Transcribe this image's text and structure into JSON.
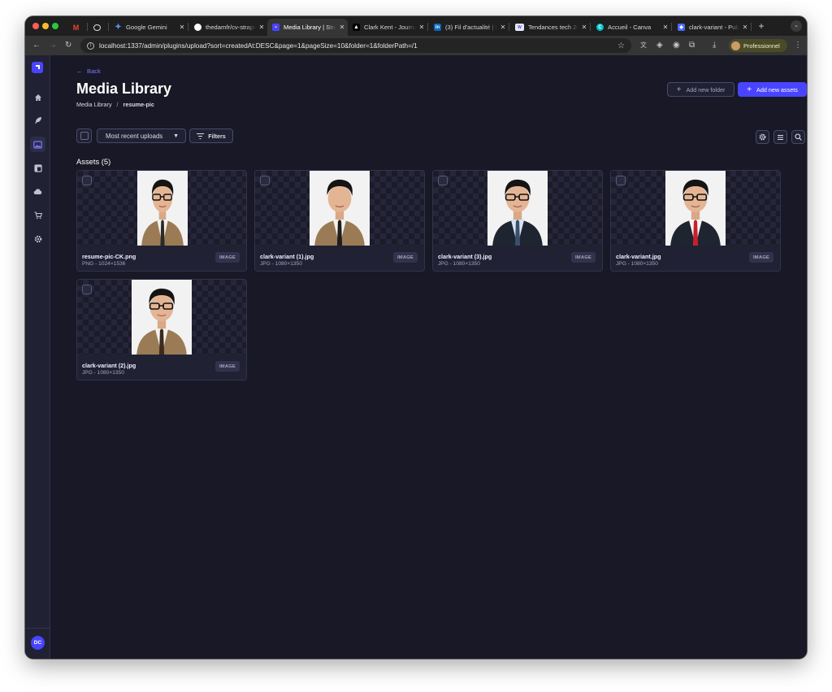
{
  "browser": {
    "tabs": [
      {
        "title": "",
        "favicon": "gmail-icon",
        "color": "#ea4335"
      },
      {
        "title": "",
        "favicon": "openai-icon",
        "color": "#ffffff"
      },
      {
        "title": "Google Gemini",
        "favicon": "gemini-icon",
        "color": "#5b8def"
      },
      {
        "title": "thedamfr/cv-strapi",
        "favicon": "github-icon",
        "color": "#ffffff"
      },
      {
        "title": "Media Library | Strapi",
        "favicon": "strapi-icon",
        "color": "#4945ff"
      },
      {
        "title": "Clark Kent - Journal",
        "favicon": "vercel-icon",
        "color": "#ffffff"
      },
      {
        "title": "(3) Fil d'actualité | LinkedIn",
        "favicon": "linkedin-icon",
        "color": "#0a66c2"
      },
      {
        "title": "Tendances tech 2025",
        "favicon": "news-icon",
        "color": "#7e7eff"
      },
      {
        "title": "Accueil - Canva",
        "favicon": "canva-icon",
        "color": "#00c4cc"
      },
      {
        "title": "clark-variant - Public",
        "favicon": "shield-icon",
        "color": "#4b6bff"
      }
    ],
    "url": "localhost:1337/admin/plugins/upload?sort=createdAt:DESC&page=1&pageSize=10&folder=1&folderPath=/1",
    "profile_label": "Professionnel"
  },
  "sidebar": {
    "items": [
      {
        "name": "home",
        "icon": "home-icon"
      },
      {
        "name": "content-type-builder",
        "icon": "feather-icon"
      },
      {
        "name": "media-library",
        "icon": "image-icon",
        "active": true
      },
      {
        "name": "content-manager",
        "icon": "layout-icon"
      },
      {
        "name": "cloud",
        "icon": "cloud-icon"
      },
      {
        "name": "marketplace",
        "icon": "cart-icon"
      },
      {
        "name": "settings",
        "icon": "gear-icon"
      }
    ],
    "user_initials": "DC"
  },
  "header": {
    "back_label": "Back",
    "title": "Media Library",
    "breadcrumb": [
      "Media Library",
      "resume-pic"
    ],
    "breadcrumb_separator": "/",
    "add_folder_label": "Add new folder",
    "add_assets_label": "Add new assets"
  },
  "toolbar": {
    "sort_label": "Most recent uploads",
    "filters_label": "Filters"
  },
  "assets": {
    "heading": "Assets (5)",
    "items": [
      {
        "name": "resume-pic-CK.png",
        "meta": "PNG - 1024×1536",
        "badge": "IMAGE",
        "tie": "#2a2a2a",
        "suit": "#9a7b55",
        "shirt": "#f4f0ea",
        "glasses": true
      },
      {
        "name": "clark-variant (1).jpg",
        "meta": "JPG - 1080×1350",
        "badge": "IMAGE",
        "tie": "#1d1d1d",
        "suit": "#9a7b55",
        "shirt": "#f4f0ea",
        "glasses": false
      },
      {
        "name": "clark-variant (3).jpg",
        "meta": "JPG - 1080×1350",
        "badge": "IMAGE",
        "tie": "#3a4f6a",
        "suit": "#1f2431",
        "shirt": "#d8e4f3",
        "glasses": true
      },
      {
        "name": "clark-variant.jpg",
        "meta": "JPG - 1080×1350",
        "badge": "IMAGE",
        "tie": "#c8202a",
        "suit": "#1f2431",
        "shirt": "#f4f4f4",
        "glasses": true
      },
      {
        "name": "clark-variant (2).jpg",
        "meta": "JPG - 1080×1350",
        "badge": "IMAGE",
        "tie": "#3a2a20",
        "suit": "#9a7b55",
        "shirt": "#f4f0ea",
        "glasses": true
      }
    ]
  },
  "colors": {
    "accent": "#4945ff",
    "background": "#181826",
    "panel": "#212134",
    "border": "#32324d"
  }
}
